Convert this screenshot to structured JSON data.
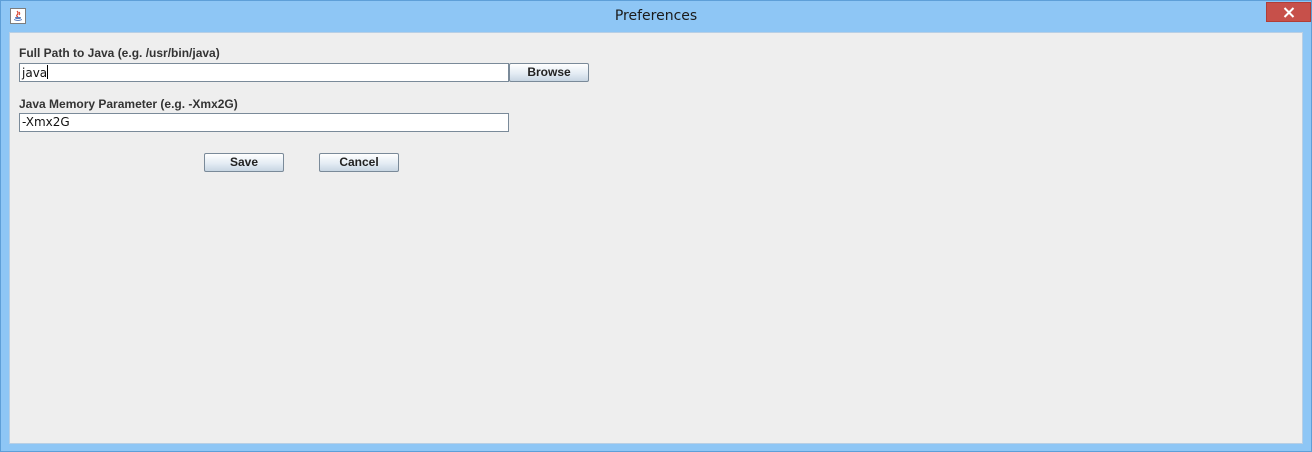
{
  "window": {
    "title": "Preferences"
  },
  "form": {
    "java_path": {
      "label": "Full Path to Java (e.g. /usr/bin/java)",
      "value": "java"
    },
    "browse_label": "Browse",
    "memory": {
      "label": "Java Memory Parameter (e.g. -Xmx2G)",
      "value": "-Xmx2G"
    },
    "save_label": "Save",
    "cancel_label": "Cancel"
  },
  "icons": {
    "app": "java-app-icon",
    "close": "close-icon"
  },
  "colors": {
    "titlebar": "#8ec6f5",
    "close_button": "#c7504a",
    "panel": "#eeeeee"
  }
}
